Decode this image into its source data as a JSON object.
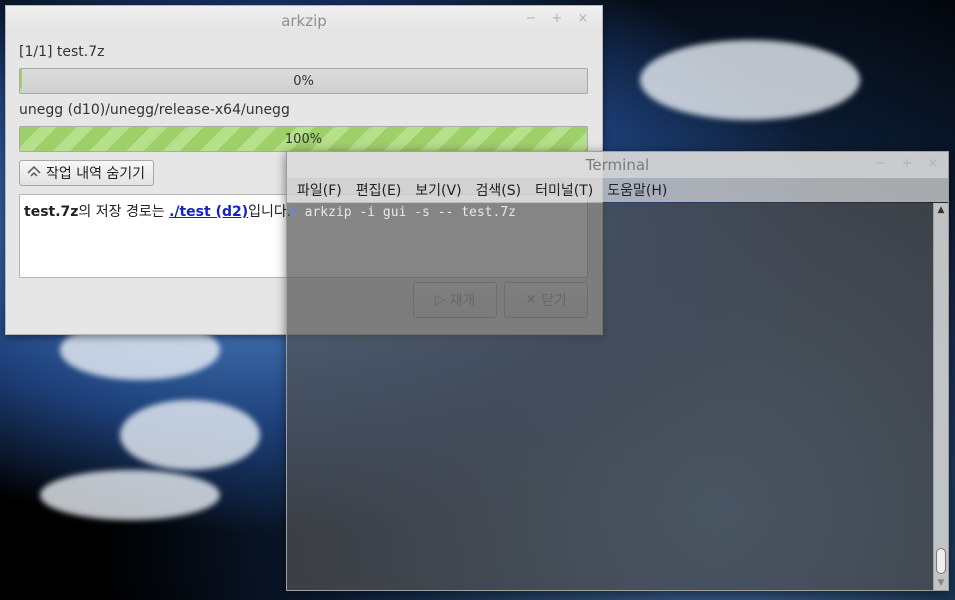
{
  "arkzip": {
    "title": "arkzip",
    "controls": {
      "minimize": "−",
      "maximize": "+",
      "close": "×"
    },
    "file_label": "[1/1] test.7z",
    "file_progress": {
      "value_percent": 0,
      "text": "0%"
    },
    "path_label": "unegg (d10)/unegg/release-x64/unegg",
    "path_progress": {
      "value_percent": 100,
      "text": "100%"
    },
    "hide_button": {
      "icon": "collapse-up-icon",
      "label": "작업 내역 숨기기"
    },
    "log": {
      "file": "test.7z",
      "text_mid": "의 저장 경로는 ",
      "link": "./test (d2)",
      "text_end": "입니다."
    },
    "resume_button": {
      "icon": "play-icon",
      "label": "재개"
    },
    "close_button": {
      "icon": "close-icon",
      "label": "닫기"
    }
  },
  "terminal": {
    "title": "Terminal",
    "controls": {
      "minimize": "−",
      "maximize": "+",
      "close": "×"
    },
    "menu": [
      "파일(F)",
      "편집(E)",
      "보기(V)",
      "검색(S)",
      "터미널(T)",
      "도움말(H)"
    ],
    "prompt": "$",
    "command": " arkzip -i gui -s -- test.7z"
  }
}
